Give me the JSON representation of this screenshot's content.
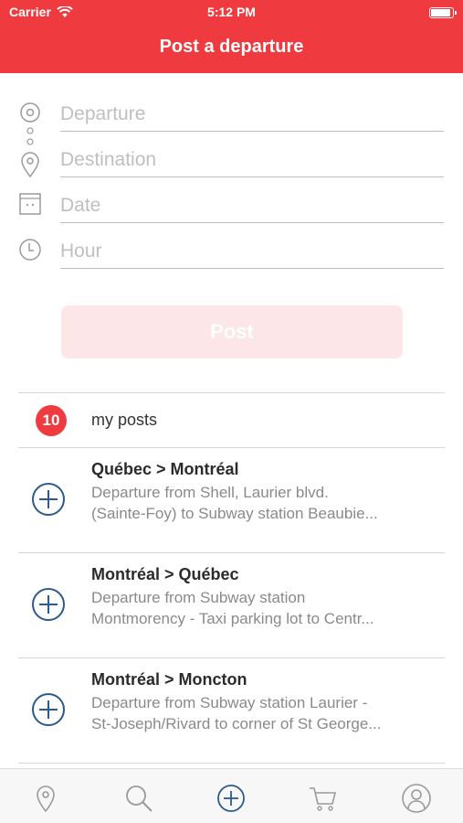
{
  "status_bar": {
    "carrier": "Carrier",
    "time": "5:12 PM",
    "battery_level": 0.95
  },
  "header": {
    "title": "Post a departure"
  },
  "form": {
    "departure_placeholder": "Departure",
    "destination_placeholder": "Destination",
    "date_placeholder": "Date",
    "hour_placeholder": "Hour",
    "post_label": "Post"
  },
  "my_posts": {
    "count": "10",
    "label": "my posts"
  },
  "routes": [
    {
      "title": "Québec > Montréal",
      "line1": "Departure from Shell, Laurier blvd.",
      "line2": "(Sainte-Foy) to Subway station Beaubie..."
    },
    {
      "title": "Montréal > Québec",
      "line1": "Departure from Subway station",
      "line2": "Montmorency - Taxi parking lot to Centr..."
    },
    {
      "title": "Montréal > Moncton",
      "line1": "Departure from Subway station Laurier -",
      "line2": "St-Joseph/Rivard to corner of St George..."
    }
  ],
  "tabbar": {
    "tabs": [
      "location-icon",
      "search-icon",
      "add-icon",
      "cart-icon",
      "profile-icon"
    ]
  },
  "colors": {
    "accent": "#ef3b3f",
    "icon_blue": "#2d5a8c",
    "icon_gray": "#9a9a9a"
  }
}
